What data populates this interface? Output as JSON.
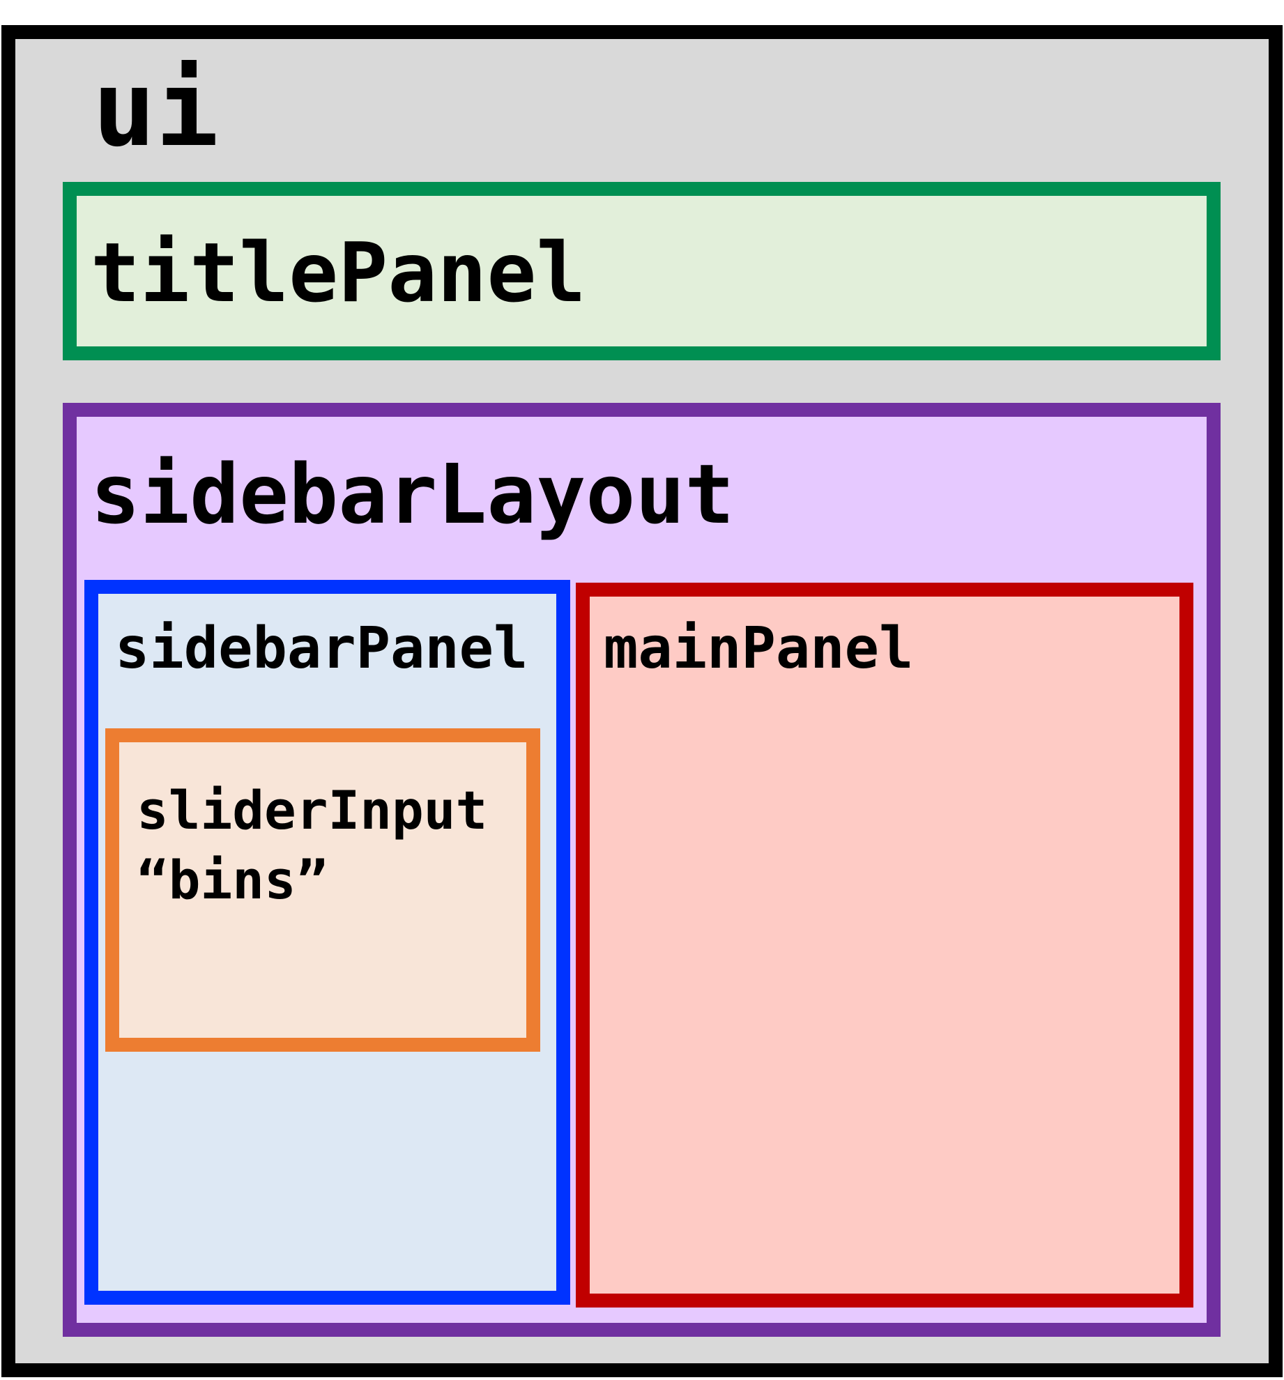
{
  "diagram": {
    "ui": {
      "label": "ui",
      "color": "#000000",
      "fill": "#d9d9d9"
    },
    "title_panel": {
      "label": "titlePanel",
      "color": "#008f52",
      "fill": "#e2efda"
    },
    "sidebar_layout": {
      "label": "sidebarLayout",
      "color": "#7030a0",
      "fill": "#e6c9ff"
    },
    "sidebar_panel": {
      "label": "sidebarPanel",
      "color": "#0033ff",
      "fill": "#dde8f4"
    },
    "slider_input": {
      "label_line1": "sliderInput",
      "label_line2": "“bins”",
      "color": "#ed7d31",
      "fill": "#f8e5d8"
    },
    "main_panel": {
      "label": "mainPanel",
      "color": "#c00000",
      "fill": "#fecbc5"
    }
  }
}
